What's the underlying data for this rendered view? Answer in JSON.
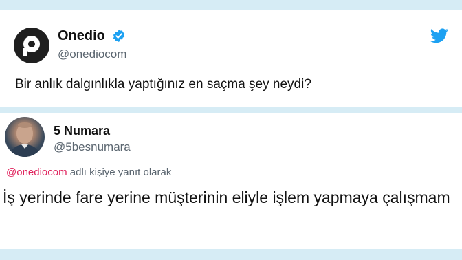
{
  "tweet1": {
    "author_name": "Onedio",
    "author_handle": "@onediocom",
    "text": "Bir anlık dalgınlıkla yaptığınız en saçma şey neydi?",
    "verified_icon": "verified-badge-icon",
    "source_icon": "twitter-bird-icon"
  },
  "tweet2": {
    "author_name": "5 Numara",
    "author_handle": "@5besnumara",
    "reply_to_user": "@onediocom",
    "reply_suffix": " adlı kişiye yanıt olarak",
    "text": "İş yerinde fare yerine müşterinin eliyle işlem yapmaya çalışmam"
  },
  "colors": {
    "background": "#d6ecf5",
    "verified_blue": "#1da1f2",
    "reply_link": "#e0245e"
  }
}
